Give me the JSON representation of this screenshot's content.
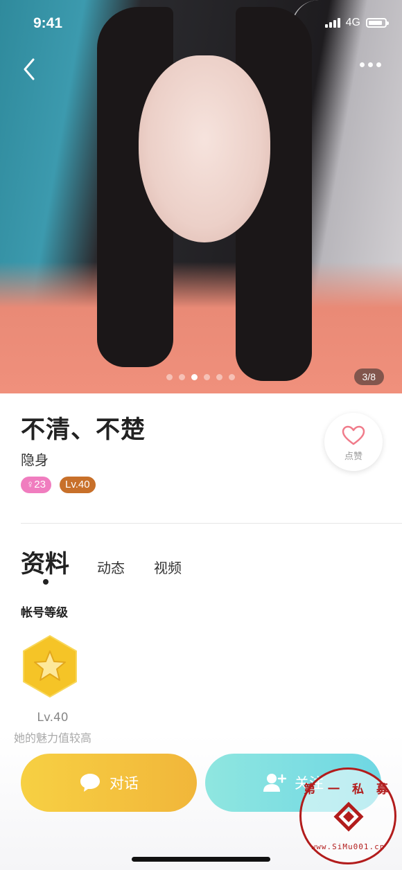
{
  "status_bar": {
    "time": "9:41",
    "network": "4G"
  },
  "gallery": {
    "counter": "3/8",
    "total_dots": 6,
    "active_dot": 2
  },
  "profile": {
    "name": "不清、不楚",
    "status": "隐身",
    "age_badge": "♀23",
    "level_badge": "Lv.40",
    "like_label": "点赞"
  },
  "tabs": [
    {
      "label": "资料",
      "active": true
    },
    {
      "label": "动态",
      "active": false
    },
    {
      "label": "视频",
      "active": false
    }
  ],
  "account_level": {
    "title": "帐号等级",
    "level": "Lv.40",
    "description": "她的魅力值较高"
  },
  "actions": {
    "chat_label": "对话",
    "follow_label": "关注"
  },
  "watermark": {
    "top": "第 一 私 募",
    "bottom": "www.SiMu001.cn"
  },
  "colors": {
    "chat": "#f1b63a",
    "follow": "#6ed7e3",
    "age_badge": "#f07dbf",
    "level_badge": "#c8702a",
    "like_heart": "#f07b8a"
  }
}
